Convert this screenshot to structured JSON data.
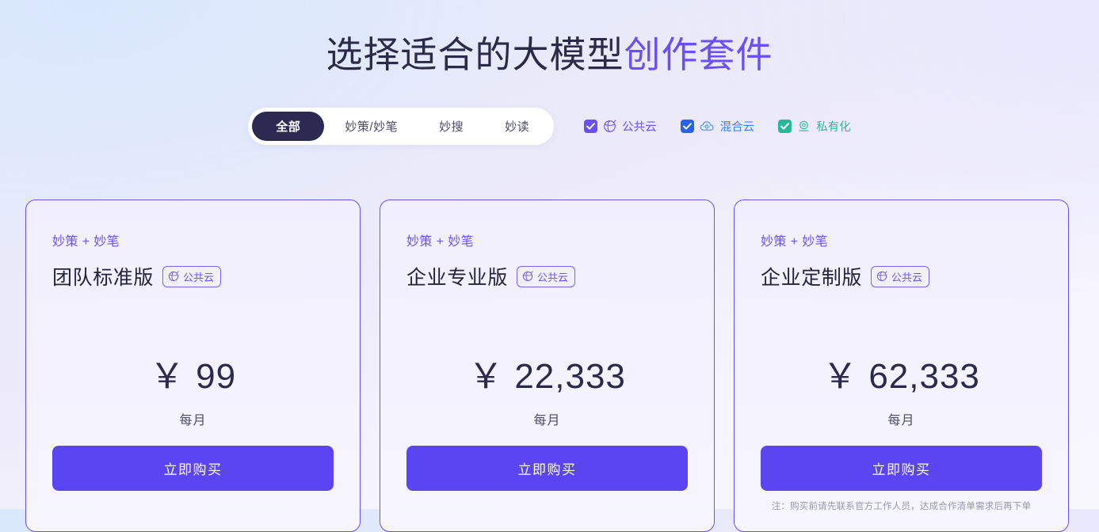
{
  "header": {
    "title_main": "选择适合的大模型",
    "title_accent": "创作套件"
  },
  "tabs": [
    {
      "label": "全部",
      "active": true
    },
    {
      "label": "妙策/妙笔",
      "active": false
    },
    {
      "label": "妙搜",
      "active": false
    },
    {
      "label": "妙读",
      "active": false
    }
  ],
  "filters": [
    {
      "label": "公共云",
      "checked": true,
      "color": "#6b4ff6",
      "icon": "globe-icon"
    },
    {
      "label": "混合云",
      "checked": true,
      "color": "#2563eb",
      "icon": "cloud-icon"
    },
    {
      "label": "私有化",
      "checked": true,
      "color": "#28b899",
      "icon": "location-pin-icon"
    }
  ],
  "cards": [
    {
      "subtitle": "妙策 + 妙笔",
      "title": "团队标准版",
      "badge": "公共云",
      "currency": "￥",
      "price": "99",
      "period": "每月",
      "button": "立即购买",
      "note": ""
    },
    {
      "subtitle": "妙策 + 妙笔",
      "title": "企业专业版",
      "badge": "公共云",
      "currency": "￥",
      "price": "22,333",
      "period": "每月",
      "button": "立即购买",
      "note": ""
    },
    {
      "subtitle": "妙策 + 妙笔",
      "title": "企业定制版",
      "badge": "公共云",
      "currency": "￥",
      "price": "62,333",
      "period": "每月",
      "button": "立即购买",
      "note": "注：购买前请先联系官方工作人员，达成合作清单需求后再下单"
    }
  ],
  "colors": {
    "accent": "#6b4ff6",
    "button": "#5b45f0",
    "card_border": "#6c4ff5",
    "active_tab": "#2c2a52"
  }
}
